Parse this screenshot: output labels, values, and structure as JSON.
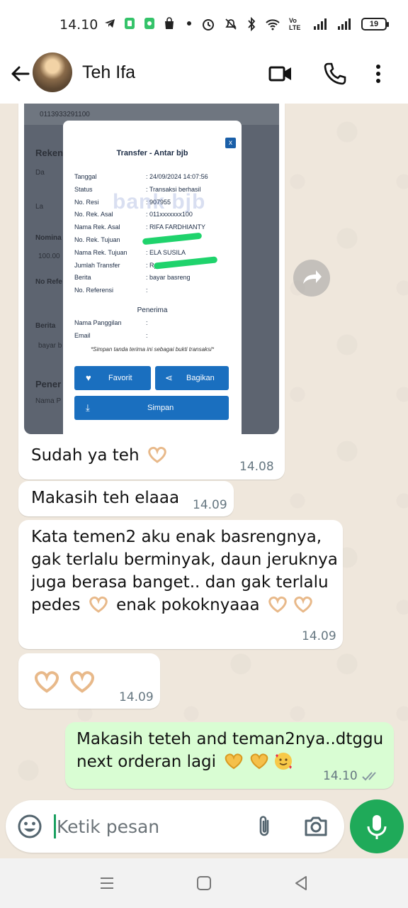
{
  "status_bar": {
    "time": "14.10",
    "network_label": "Vo LTE",
    "battery": "19"
  },
  "header": {
    "contact_name": "Teh Ifa"
  },
  "transfer_screenshot": {
    "account_number": "0113933291100",
    "bg_labels": {
      "rekening": "Reken",
      "nominal": "Nomina",
      "nominal_value": "100.00",
      "no_ref": "No Refe",
      "berita": "Berita",
      "berita_value": "bayar b",
      "penerima": "Pener",
      "nama_p": "Nama P",
      "opt_da": "Da",
      "opt_la": "La"
    },
    "dialog_title": "Transfer - Antar bjb",
    "close_label": "x",
    "watermark": "bank bjb",
    "rows": [
      {
        "key": "Tanggal",
        "value": ": 24/09/2024 14:07:56"
      },
      {
        "key": "Status",
        "value": ": Transaksi berhasil"
      },
      {
        "key": "No. Resi",
        "value": ": 907955"
      },
      {
        "key": "No. Rek. Asal",
        "value": ": 011xxxxxxx100"
      },
      {
        "key": "Nama Rek. Asal",
        "value": ": RIFA FARDHIANTY"
      },
      {
        "key": "No. Rek. Tujuan",
        "value": ":"
      },
      {
        "key": "Nama Rek. Tujuan",
        "value": ": ELA SUSILA"
      },
      {
        "key": "Jumlah Transfer",
        "value": ": Rp"
      },
      {
        "key": "Berita",
        "value": ": bayar basreng"
      },
      {
        "key": "No. Referensi",
        "value": ":"
      }
    ],
    "penerima_title": "Penerima",
    "penerima_rows": [
      {
        "key": "Nama Panggilan",
        "value": ":"
      },
      {
        "key": "Email",
        "value": ":"
      }
    ],
    "note": "*Simpan tanda terima ini sebagai bukti transaksi*",
    "buttons": {
      "favorit": "Favorit",
      "bagikan": "Bagikan",
      "simpan": "Simpan"
    }
  },
  "messages": [
    {
      "direction": "in",
      "text": "Sudah ya teh",
      "time": "14.08"
    },
    {
      "direction": "in",
      "text": "Makasih teh elaaa",
      "time": "14.09"
    },
    {
      "direction": "in",
      "lines": [
        "Kata temen2 aku enak basrengnya,",
        "gak terlalu berminyak, daun jeruknya",
        "juga berasa banget.. dan gak terlalu",
        "pedes",
        "enak pokoknyaaa"
      ],
      "time": "14.09"
    },
    {
      "direction": "in",
      "text": "",
      "time": "14.09"
    },
    {
      "direction": "out",
      "lines": [
        "Makasih teteh and teman2nya..dtggu",
        "next orderan lagi"
      ],
      "time": "14.10"
    }
  ],
  "input": {
    "placeholder": "Ketik pesan"
  },
  "icons": {
    "emoji": "emoji-icon",
    "attach": "paperclip-icon",
    "camera": "camera-icon",
    "mic": "mic-icon",
    "video": "video-call-icon",
    "call": "phone-icon",
    "menu": "more-vert-icon"
  },
  "colors": {
    "chat_bg": "#efe7dc",
    "incoming": "#ffffff",
    "outgoing": "#d9fdd3",
    "accent": "#1faa59",
    "bank_blue": "#1a6fbf"
  }
}
